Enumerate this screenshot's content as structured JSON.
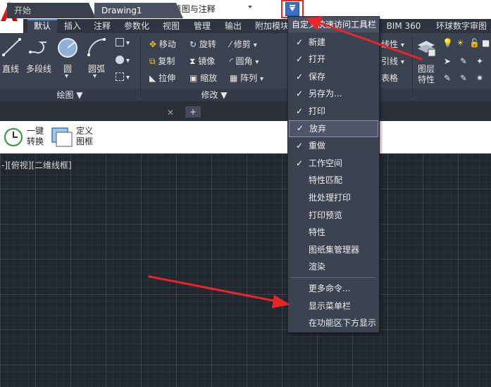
{
  "quick_access": {
    "workspace": "草图与注释",
    "icons": [
      "new-icon",
      "open-icon",
      "save-icon",
      "save-as-icon",
      "print-icon",
      "undo-icon",
      "redo-icon"
    ]
  },
  "ribbon_tabs": [
    "默认",
    "插入",
    "注释",
    "参数化",
    "视图",
    "管理",
    "输出",
    "附加模块",
    "BIM 360",
    "环球数字审图"
  ],
  "ribbon": {
    "draw": {
      "line": "直线",
      "polyline": "多段线",
      "circle": "圆",
      "arc": "圆弧",
      "panel": "绘图 ▼"
    },
    "modify": {
      "move": "移动",
      "rotate": "旋转",
      "trim": "修剪",
      "copy": "复制",
      "mirror": "镜像",
      "fillet": "圆角",
      "stretch": "拉伸",
      "scale": "缩放",
      "array": "阵列",
      "panel": "修改 ▼"
    },
    "partial": {
      "linetype": "线性",
      "leader": "引线",
      "table": "表格"
    },
    "layers": {
      "properties_line1": "图层",
      "properties_line2": "特性"
    }
  },
  "file_tabs": {
    "start": "开始",
    "drawing": "Drawing1",
    "close": "✕",
    "add": "+"
  },
  "tool_strip": {
    "convert_line1": "一键",
    "convert_line2": "转换",
    "frame_line1": "定义",
    "frame_line2": "图框"
  },
  "viewport_label": "-][俯视][二维线框]",
  "menu": {
    "title": "自定义快速访问工具栏",
    "items": [
      {
        "label": "新建",
        "checked": true
      },
      {
        "label": "打开",
        "checked": true
      },
      {
        "label": "保存",
        "checked": true
      },
      {
        "label": "另存为...",
        "checked": true
      },
      {
        "label": "打印",
        "checked": true
      },
      {
        "label": "放弃",
        "checked": true
      },
      {
        "label": "重做",
        "checked": true
      },
      {
        "label": "工作空间",
        "checked": true
      },
      {
        "label": "特性匹配",
        "checked": false
      },
      {
        "label": "批处理打印",
        "checked": false
      },
      {
        "label": "打印预览",
        "checked": false
      },
      {
        "label": "特性",
        "checked": false
      },
      {
        "label": "图纸集管理器",
        "checked": false
      },
      {
        "label": "渲染",
        "checked": false
      }
    ],
    "more": "更多命令...",
    "show_menubar": "显示菜单栏",
    "show_below": "在功能区下方显示"
  },
  "check_mark": "✓",
  "colors": {
    "accent": "#3d6fc7",
    "annotation": "#e8262a",
    "ribbon_bg": "#3b4250",
    "canvas_bg": "#212830"
  }
}
